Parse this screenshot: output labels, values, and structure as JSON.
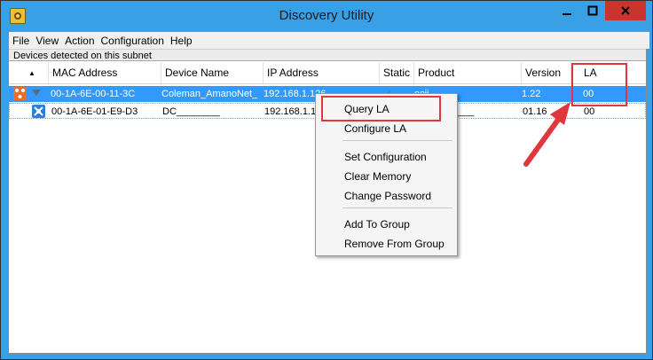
{
  "window": {
    "title": "Discovery Utility"
  },
  "menu": [
    "File",
    "View",
    "Action",
    "Configuration",
    "Help"
  ],
  "subnet_label": "Devices detected on this subnet",
  "columns": [
    "MAC Address",
    "Device Name",
    "IP Address",
    "Static",
    "Product",
    "Version",
    "LA"
  ],
  "rows": [
    {
      "mac": "00-1A-6E-00-11-3C",
      "name": "Coleman_AmanoNet_",
      "ip": "192.168.1.126",
      "static": "✓",
      "product": "ecii",
      "version": "1.22",
      "la": "00",
      "selected": true
    },
    {
      "mac": "00-1A-6E-01-E9-D3",
      "name": "DC________",
      "ip": "192.168.1.1",
      "static": "",
      "product": "___",
      "version": "01.16",
      "la": "00",
      "selected": false
    }
  ],
  "context_menu": {
    "items": [
      "Query LA",
      "Configure LA",
      "Set Configuration",
      "Clear Memory",
      "Change Password",
      "Add To Group",
      "Remove From Group"
    ]
  },
  "icons": {
    "app": "app-icon",
    "row1": "device-orange-icon",
    "row2": "device-blue-icon",
    "expand": "triangle-down-icon"
  },
  "colors": {
    "titlebar": "#3aa0e6",
    "selection": "#3399ff",
    "highlight": "#e0363c",
    "close": "#c7352c"
  }
}
